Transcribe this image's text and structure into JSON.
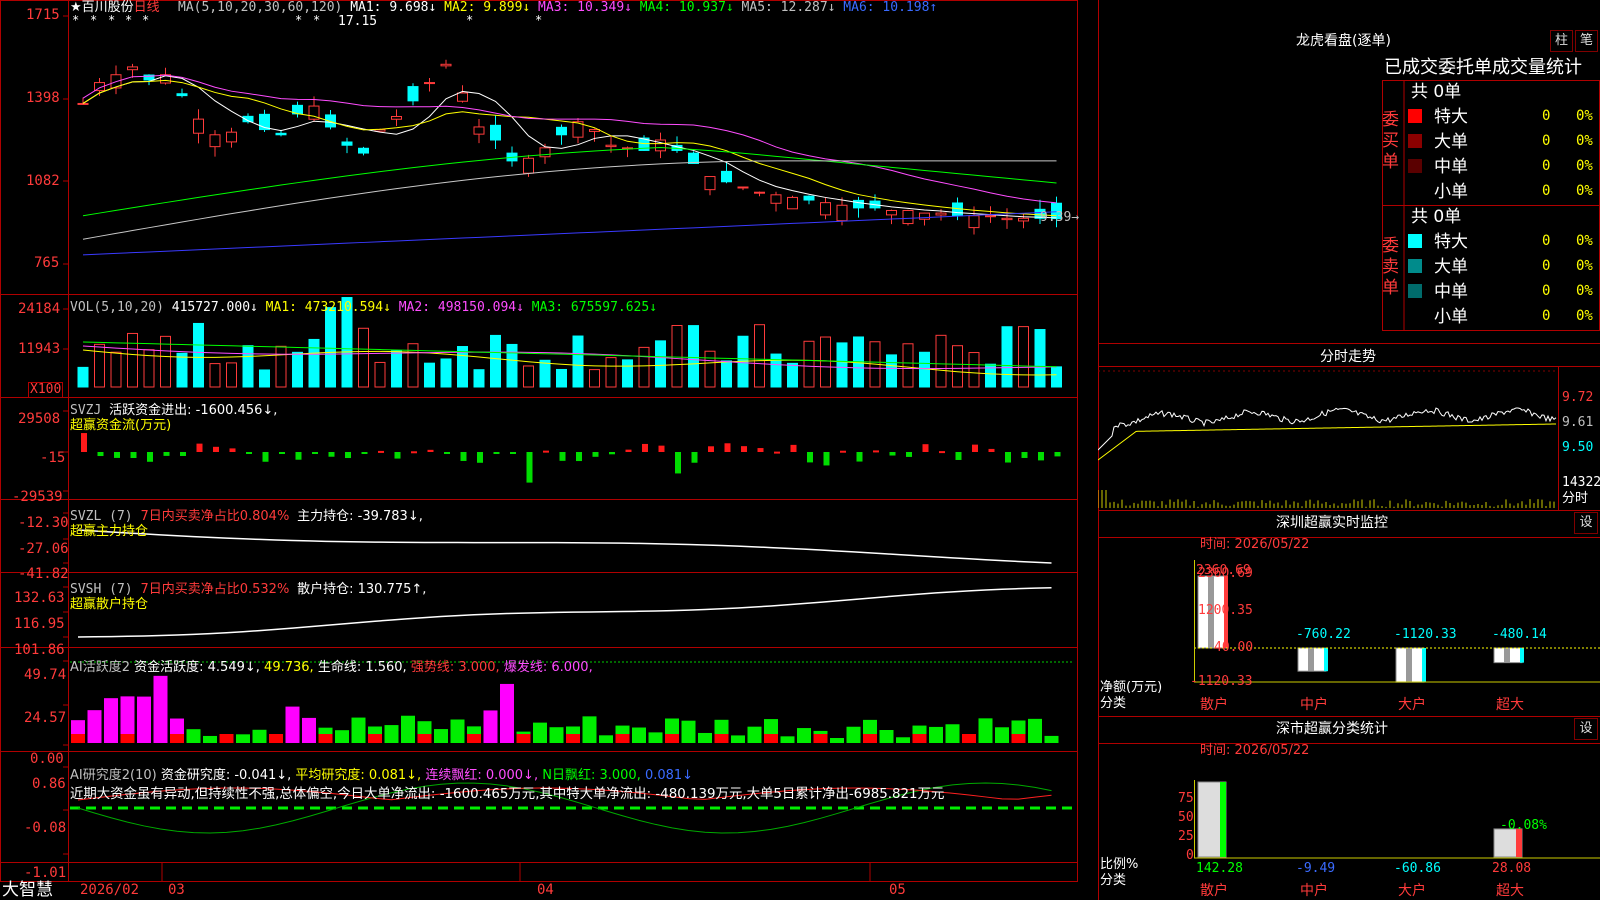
{
  "stock": {
    "star": "★",
    "name": "百川股份",
    "period": "日线"
  },
  "ma_line": {
    "label": "MA(5,10,20,30,60,120)",
    "ma1": "MA1: 9.698↓",
    "ma2": "MA2: 9.899↓",
    "ma3": "MA3: 10.349↓",
    "ma4": "MA4: 10.937↓",
    "ma5": "MA5: 12.287↓",
    "ma6": "MA6: 10.198↑"
  },
  "price_panel": {
    "ticks": [
      "1715",
      "1398",
      "1082",
      "765"
    ],
    "high_label": "17.15",
    "last_label": "9.39→",
    "markers": [
      "*",
      "*",
      "*",
      "*",
      "*",
      "*",
      "*",
      "*",
      "*"
    ]
  },
  "vol_panel": {
    "label": "VOL(5,10,20)",
    "value": "415727.000↓",
    "ma1": "MA1: 473210.594↓",
    "ma2": "MA2: 498150.094↓",
    "ma3": "MA3: 675597.625↓",
    "ticks": [
      "24184",
      "11943"
    ],
    "unit": "X100"
  },
  "svzj_panel": {
    "label": "SVZJ",
    "text": "活跃资金进出: -1600.456↓,",
    "subtitle": "超赢资金流(万元)",
    "ticks": [
      "29508",
      "-15",
      "-29539"
    ]
  },
  "svzl_panel": {
    "label": "SVZL (7)",
    "ratio": "7日内买卖净占比0.804%",
    "text": "主力持仓: -39.783↓,",
    "subtitle": "超赢主力持仓",
    "ticks": [
      "-12.30",
      "-27.06",
      "-41.82"
    ]
  },
  "svsh_panel": {
    "label": "SVSH (7)",
    "ratio": "7日内买卖净占比0.532%",
    "text": "散户持仓: 130.775↑,",
    "subtitle": "超赢散户持仓",
    "ticks": [
      "132.63",
      "116.95",
      "101.86"
    ]
  },
  "ai_act_panel": {
    "label": "AI活跃度2",
    "t1": "资金活跃度: 4.549↓,",
    "t2": "49.736,",
    "t3": "生命线: 1.560,",
    "t4": "强势线: 3.000,",
    "t5": "爆发线: 6.000,",
    "ticks": [
      "49.74",
      "24.57",
      "0.00"
    ]
  },
  "ai_res_panel": {
    "label": "AI研究度2(10)",
    "t1": "资金研究度: -0.041↓,",
    "t2": "平均研究度: 0.081↓,",
    "t3": "连续飘红: 0.000↓,",
    "t4": "N日飘红: 3.000,",
    "t5": "0.081↓",
    "comment": "近期大资金虽有异动,但持续性不强,总体偏空,今日大单净流出: -1600.465万元,其中特大单净流出: -480.139万元,大单5日累计净出-6985.821万元",
    "ticks": [
      "0.86",
      "-0.08",
      "-1.01"
    ]
  },
  "x_axis": {
    "brand": "大智慧",
    "labels": [
      "2026/02",
      "03",
      "04",
      "05"
    ]
  },
  "dragon": {
    "title": "龙虎看盘(逐单)",
    "btn1": "柱",
    "btn2": "笔",
    "tabs": "已成交委托单成交量统计",
    "buy_label": "委买单",
    "sell_label": "委卖单",
    "buy_total": "共 0单",
    "sell_total": "共 0单",
    "buy_rows": [
      {
        "name": "特大",
        "vol": "0",
        "pct": "0%",
        "color": "#ff0000"
      },
      {
        "name": "大单",
        "vol": "0",
        "pct": "0%",
        "color": "#8b0000"
      },
      {
        "name": "中单",
        "vol": "0",
        "pct": "0%",
        "color": "#5a0000"
      },
      {
        "name": "小单",
        "vol": "0",
        "pct": "0%",
        "color": "#000000"
      }
    ],
    "sell_rows": [
      {
        "name": "特大",
        "vol": "0",
        "pct": "0%",
        "color": "#00ffff"
      },
      {
        "name": "大单",
        "vol": "0",
        "pct": "0%",
        "color": "#008b8b"
      },
      {
        "name": "中单",
        "vol": "0",
        "pct": "0%",
        "color": "#006b6b"
      },
      {
        "name": "小单",
        "vol": "0",
        "pct": "0%",
        "color": "#000000"
      }
    ]
  },
  "intraday": {
    "title": "分时走势",
    "ticks": [
      "9.72",
      "9.61",
      "9.50"
    ],
    "vol_tick": "14322",
    "vol_unit": "分时"
  },
  "monitor": {
    "title": "深圳超赢实时监控",
    "btn": "设",
    "time": "时间: 2026/05/22",
    "ticks": [
      "2360.69",
      "1200.35",
      "40.00",
      "-1120.33"
    ],
    "ylabel": "净额(万元)",
    "xlabel": "分类",
    "bars": [
      {
        "name": "散户",
        "value": 2360.69,
        "label": "2360.69"
      },
      {
        "name": "中户",
        "value": -760.22,
        "label": "-760.22"
      },
      {
        "name": "大户",
        "value": -1120.33,
        "label": "-1120.33"
      },
      {
        "name": "超大",
        "value": -480.14,
        "label": "-480.14"
      }
    ]
  },
  "classify": {
    "title": "深市超赢分类统计",
    "btn": "设",
    "time": "时间: 2026/05/22",
    "ticks": [
      "75",
      "50",
      "25",
      "0"
    ],
    "ylabel": "比例%",
    "xlabel": "分类",
    "pct_label": "-0.08%",
    "bars": [
      {
        "name": "散户",
        "value": 142.28,
        "label": "142.28"
      },
      {
        "name": "中户",
        "value": -9.49,
        "label": "-9.49"
      },
      {
        "name": "大户",
        "value": -60.86,
        "label": "-60.86"
      },
      {
        "name": "超大",
        "value": 28.08,
        "label": "28.08"
      }
    ]
  },
  "colors": {
    "up": "#ff3b3b",
    "down": "#00ffff",
    "frame": "#b00000",
    "ma1": "#ffffff",
    "ma2": "#ffff00",
    "ma3": "#ff4dff",
    "ma4": "#00ff00",
    "ma5": "#c8c8c8",
    "ma6": "#3a3aff"
  }
}
